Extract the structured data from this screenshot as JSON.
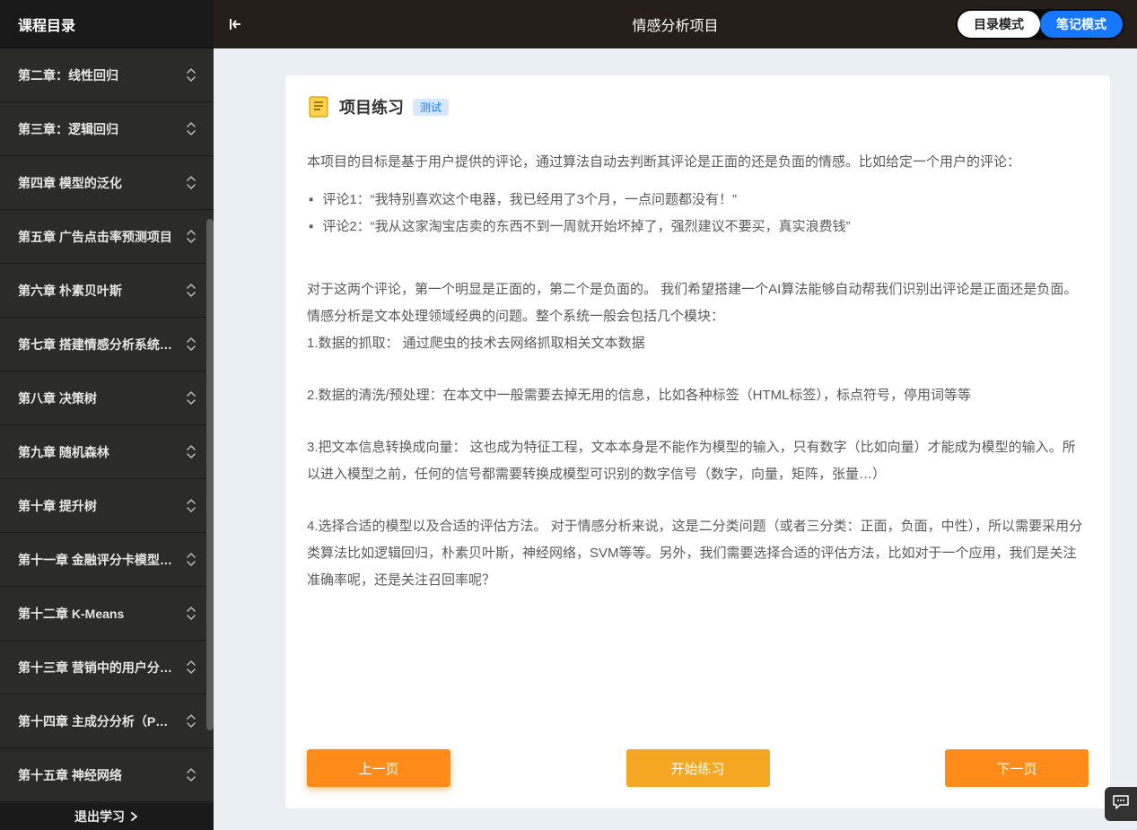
{
  "sidebar": {
    "title": "课程目录",
    "items": [
      "第二章：线性回归",
      "第三章：逻辑回归",
      "第四章 模型的泛化",
      "第五章 广告点击率预测项目",
      "第六章 朴素贝叶斯",
      "第七章 搭建情感分析系统…",
      "第八章 决策树",
      "第九章 随机森林",
      "第十章 提升树",
      "第十一章 金融评分卡模型…",
      "第十二章 K-Means",
      "第十三章 营销中的用户分…",
      "第十四章 主成分分析（P…",
      "第十五章 神经网络"
    ],
    "footer": "退出学习"
  },
  "topbar": {
    "title": "情感分析项目",
    "mode_outline": "目录模式",
    "mode_notes": "笔记模式"
  },
  "content": {
    "title": "项目练习",
    "badge": "测试",
    "intro": "本项目的目标是基于用户提供的评论，通过算法自动去判断其评论是正面的还是负面的情感。比如给定一个用户的评论：",
    "review1": "评论1：“我特别喜欢这个电器，我已经用了3个月，一点问题都没有！”",
    "review2": "评论2：“我从这家淘宝店卖的东西不到一周就开始坏掉了，强烈建议不要买，真实浪费钱”",
    "para1": "对于这两个评论，第一个明显是正面的，第二个是负面的。 我们希望搭建一个AI算法能够自动帮我们识别出评论是正面还是负面。",
    "para2": "情感分析是文本处理领域经典的问题。整个系统一般会包括几个模块：",
    "step1": "1.数据的抓取： 通过爬虫的技术去网络抓取相关文本数据",
    "step2": "2.数据的清洗/预处理：在本文中一般需要去掉无用的信息，比如各种标签（HTML标签），标点符号，停用词等等",
    "step3": "3.把文本信息转换成向量： 这也成为特征工程，文本本身是不能作为模型的输入，只有数字（比如向量）才能成为模型的输入。所以进入模型之前，任何的信号都需要转换成模型可识别的数字信号（数字，向量，矩阵，张量…）",
    "step4": "4.选择合适的模型以及合适的评估方法。 对于情感分析来说，这是二分类问题（或者三分类：正面，负面，中性），所以需要采用分类算法比如逻辑回归，朴素贝叶斯，神经网络，SVM等等。另外，我们需要选择合适的评估方法，比如对于一个应用，我们是关注准确率呢，还是关注召回率呢？",
    "prev": "上一页",
    "start": "开始练习",
    "next": "下一页"
  }
}
